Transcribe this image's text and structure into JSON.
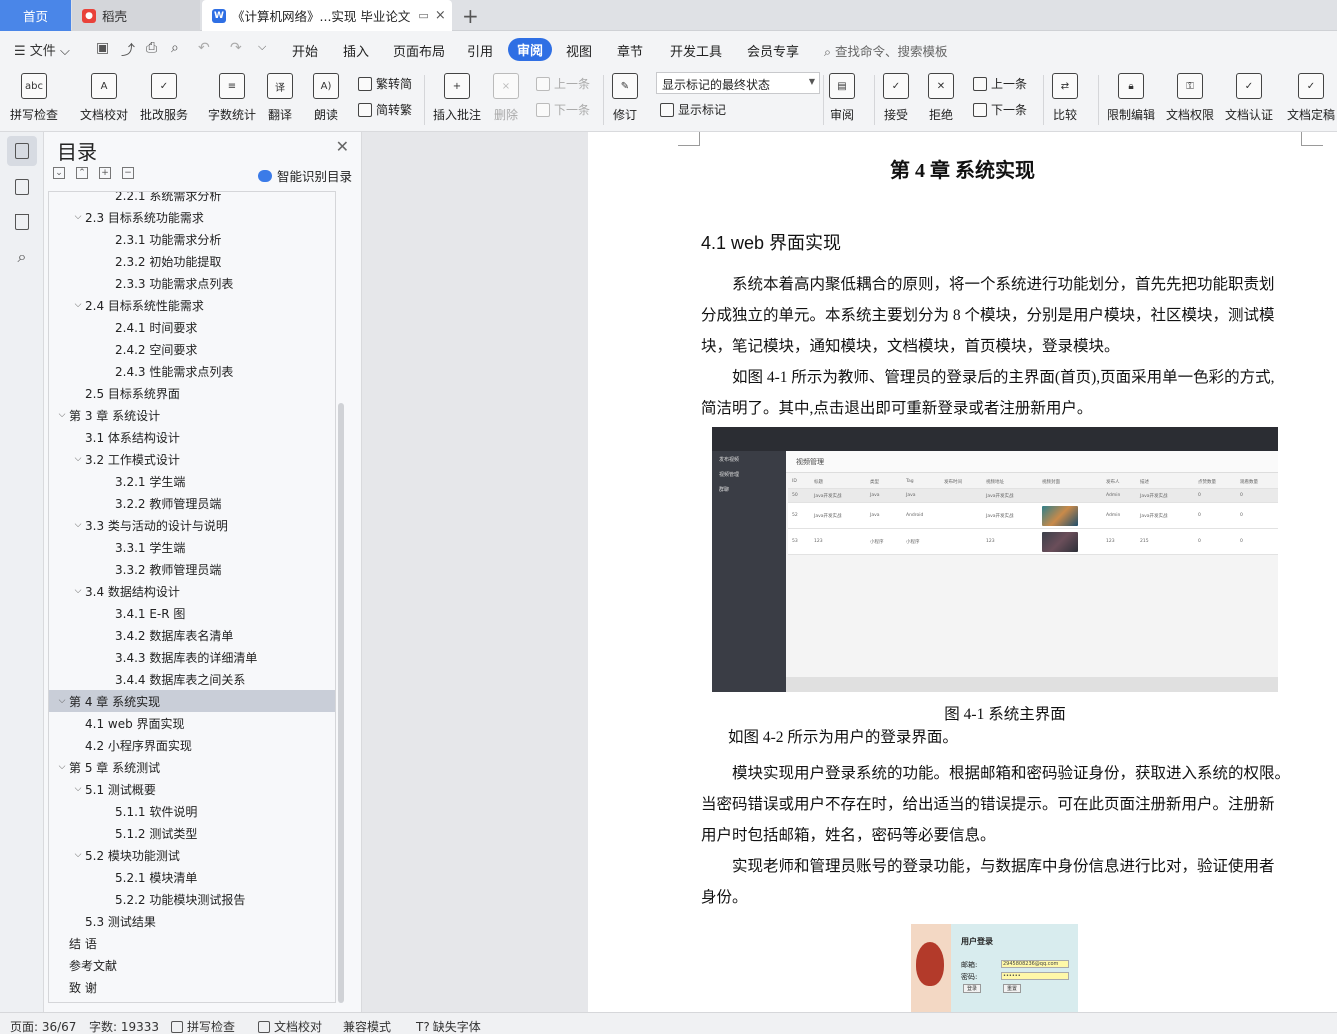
{
  "tabs": {
    "home": "首页",
    "daoke": "稻壳",
    "doc": "《计算机网络》...实现 毕业论文",
    "add": "+"
  },
  "menubar": {
    "file": "文件",
    "tabs": [
      "开始",
      "插入",
      "页面布局",
      "引用",
      "审阅",
      "视图",
      "章节",
      "开发工具",
      "会员专享"
    ],
    "active_tab": "审阅",
    "search": "查找命令、搜索模板"
  },
  "ribbon": {
    "spell_check": "拼写检查",
    "doc_proof": "文档校对",
    "correction_service": "批改服务",
    "word_count": "字数统计",
    "translate": "翻译",
    "read_aloud": "朗读",
    "to_traditional": "繁转简",
    "to_simplified": "简转繁",
    "insert_comment": "插入批注",
    "delete": "删除",
    "prev_comment": "上一条",
    "next_comment": "下一条",
    "revise": "修订",
    "markup_state": "显示标记的最终状态",
    "show_markup": "显示标记",
    "review": "审阅",
    "accept": "接受",
    "reject": "拒绝",
    "prev": "上一条",
    "next": "下一条",
    "compare": "比较",
    "restrict_edit": "限制编辑",
    "doc_permission": "文档权限",
    "doc_certify": "文档认证",
    "doc_finalize": "文档定稿"
  },
  "toc": {
    "title": "目录",
    "smart": "智能识别目录",
    "items": [
      {
        "level": 3,
        "text": "2.2.1 系统需求分析",
        "caret": ""
      },
      {
        "level": 2,
        "text": "2.3 目标系统功能需求",
        "caret": "v"
      },
      {
        "level": 3,
        "text": "2.3.1 功能需求分析",
        "caret": ""
      },
      {
        "level": 3,
        "text": "2.3.2 初始功能提取",
        "caret": ""
      },
      {
        "level": 3,
        "text": "2.3.3  功能需求点列表",
        "caret": ""
      },
      {
        "level": 2,
        "text": "2.4 目标系统性能需求",
        "caret": "v"
      },
      {
        "level": 3,
        "text": "2.4.1  时间要求",
        "caret": ""
      },
      {
        "level": 3,
        "text": "2.4.2  空间要求",
        "caret": ""
      },
      {
        "level": 3,
        "text": "2.4.3  性能需求点列表",
        "caret": ""
      },
      {
        "level": 2,
        "text": "2.5 目标系统界面",
        "caret": ""
      },
      {
        "level": 1,
        "text": "第 3 章  系统设计",
        "caret": "v"
      },
      {
        "level": 2,
        "text": "3.1  体系结构设计",
        "caret": ""
      },
      {
        "level": 2,
        "text": "3.2  工作模式设计",
        "caret": "v"
      },
      {
        "level": 3,
        "text": "3.2.1  学生端",
        "caret": ""
      },
      {
        "level": 3,
        "text": "3.2.2 教师管理员端",
        "caret": ""
      },
      {
        "level": 2,
        "text": "3.3 类与活动的设计与说明",
        "caret": "v"
      },
      {
        "level": 3,
        "text": "3.3.1  学生端",
        "caret": ""
      },
      {
        "level": 3,
        "text": "3.3.2 教师管理员端",
        "caret": ""
      },
      {
        "level": 2,
        "text": "3.4 数据结构设计",
        "caret": "v"
      },
      {
        "level": 3,
        "text": "3.4.1 E-R 图",
        "caret": ""
      },
      {
        "level": 3,
        "text": "3.4.2  数据库表名清单",
        "caret": ""
      },
      {
        "level": 3,
        "text": "3.4.3  数据库表的详细清单",
        "caret": ""
      },
      {
        "level": 3,
        "text": "3.4.4  数据库表之间关系",
        "caret": ""
      },
      {
        "level": 1,
        "text": "第 4 章  系统实现",
        "caret": "v",
        "selected": true
      },
      {
        "level": 2,
        "text": "4.1 web 界面实现",
        "caret": ""
      },
      {
        "level": 2,
        "text": "4.2  小程序界面实现",
        "caret": ""
      },
      {
        "level": 1,
        "text": "第 5 章  系统测试",
        "caret": "v"
      },
      {
        "level": 2,
        "text": "5.1  测试概要",
        "caret": "v"
      },
      {
        "level": 3,
        "text": "5.1.1  软件说明",
        "caret": ""
      },
      {
        "level": 3,
        "text": "5.1.2  测试类型",
        "caret": ""
      },
      {
        "level": 2,
        "text": "5.2 模块功能测试",
        "caret": "v"
      },
      {
        "level": 3,
        "text": "5.2.1 模块清单",
        "caret": ""
      },
      {
        "level": 3,
        "text": "5.2.2 功能模块测试报告",
        "caret": ""
      },
      {
        "level": 2,
        "text": "5.3  测试结果",
        "caret": ""
      },
      {
        "level": 1,
        "text": "结    语",
        "caret": ""
      },
      {
        "level": 1,
        "text": "参考文献",
        "caret": ""
      },
      {
        "level": 1,
        "text": "致  谢",
        "caret": ""
      }
    ]
  },
  "doc": {
    "chapter_title": "第 4 章  系统实现",
    "section_title": "4.1 web 界面实现",
    "para1_lines": [
      "        系统本着高内聚低耦合的原则，将一个系统进行功能划分，首先先把功能职责划",
      "分成独立的单元。本系统主要划分为 8 个模块，分别是用户模块，社区模块，测试模",
      "块，笔记模块，通知模块，文档模块，首页模块，登录模块。"
    ],
    "para2_lines": [
      "        如图 4-1 所示为教师、管理员的登录后的主界面(首页),页面采用单一色彩的方式,",
      "简洁明了。其中,点击退出即可重新登录或者注册新用户。"
    ],
    "fig1_caption": "图 4-1  系统主界面",
    "para3": "如图 4-2 所示为用户的登录界面。",
    "para4_lines": [
      "        模块实现用户登录系统的功能。根据邮箱和密码验证身份，获取进入系统的权限。",
      "当密码错误或用户不存在时，给出适当的错误提示。可在此页面注册新用户。注册新",
      "用户时包括邮箱，姓名，密码等必要信息。"
    ],
    "para5_lines": [
      "        实现老师和管理员账号的登录功能，与数据库中身份信息进行比对，验证使用者",
      "身份。"
    ],
    "fig1": {
      "sidebar": [
        "发布视频",
        "视频管理",
        "群聊"
      ],
      "header": "视频管理",
      "columns": [
        "ID",
        "标题",
        "类型",
        "Tag",
        "发布时间",
        "视频地址",
        "视频封面",
        "发布人",
        "描述",
        "点赞数量",
        "观看数量"
      ],
      "rows": [
        [
          "50",
          "Java开发实战",
          "Java",
          "Java",
          "",
          "Java开发实战",
          "",
          "Admin",
          "Java开发实战",
          "0",
          "0"
        ],
        [
          "52",
          "Java开发实战",
          "Java",
          "Android",
          "",
          "Java开发实战",
          "",
          "Admin",
          "Java开发实战",
          "0",
          "0"
        ],
        [
          "53",
          "123",
          "小程序",
          "小程序",
          "",
          "123",
          "",
          "123",
          "215",
          "0",
          "0"
        ]
      ]
    },
    "fig2": {
      "title": "用户登录",
      "email_label": "邮箱:",
      "email_value": "2945808236@qq.com",
      "password_label": "密码:",
      "password_value": "••••••",
      "login_btn": "登录",
      "reset_btn": "重置"
    }
  },
  "status": {
    "page": "页面: 36/67",
    "words": "字数: 19333",
    "spell": "拼写检查",
    "proof": "文档校对",
    "compat": "兼容模式",
    "missing_font": "缺失字体"
  }
}
